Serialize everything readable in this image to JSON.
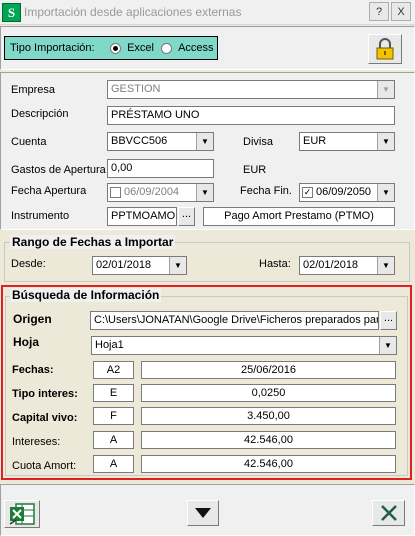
{
  "window": {
    "title": "Importación desde aplicaciones externas",
    "app_icon_letter": "S",
    "help_label": "?",
    "close_label": "X"
  },
  "tipo": {
    "label": "Tipo Importación:",
    "options": [
      "Excel",
      "Access"
    ],
    "selected": "Excel"
  },
  "fields": {
    "empresa_label": "Empresa",
    "empresa_value": "GESTION",
    "descripcion_label": "Descripción",
    "descripcion_value": "PRÉSTAMO UNO",
    "cuenta_label": "Cuenta",
    "cuenta_value": "BBVCC506",
    "divisa_label": "Divisa",
    "divisa_value": "EUR",
    "gastos_label": "Gastos de Apertura",
    "gastos_value": "0,00",
    "gastos_currency": "EUR",
    "fecha_apertura_label": "Fecha Apertura",
    "fecha_apertura_value": "06/09/2004",
    "fecha_fin_label": "Fecha Fin.",
    "fecha_fin_value": "06/09/2050",
    "fecha_fin_checked": "✓",
    "instrumento_label": "Instrumento",
    "instrumento_value": "PPTMOAMO",
    "instrumento_btn": "...",
    "instrumento_desc": "Pago Amort Prestamo (PTMO)"
  },
  "rango": {
    "legend": "Rango de Fechas a Importar",
    "desde_label": "Desde:",
    "desde_value": "02/01/2018",
    "hasta_label": "Hasta:",
    "hasta_value": "02/01/2018"
  },
  "busqueda": {
    "legend": "Búsqueda de Información",
    "origen_label": "Origen",
    "origen_value": "C:\\Users\\JONATAN\\Google Drive\\Ficheros preparados par",
    "origen_btn": "...",
    "hoja_label": "Hoja",
    "hoja_value": "Hoja1",
    "rows": [
      {
        "label": "Fechas:",
        "bold": true,
        "col": "A2",
        "value": "25/06/2016"
      },
      {
        "label": "Tipo interes:",
        "bold": true,
        "col": "E",
        "value": "0,0250"
      },
      {
        "label": "Capital vivo:",
        "bold": true,
        "col": "F",
        "value": "3.450,00"
      },
      {
        "label": "Intereses:",
        "bold": false,
        "col": "A",
        "value": "42.546,00"
      },
      {
        "label": "Cuota Amort:",
        "bold": false,
        "col": "A",
        "value": "42.546,00"
      }
    ]
  },
  "colors": {
    "accent_green": "#1f7a3a",
    "highlight_red": "#e02020",
    "lock_yellow": "#f2c400",
    "tipo_bg": "#7fd8c8"
  },
  "icons": [
    "excel-icon",
    "arrow-down-icon",
    "close-x-icon",
    "lock-icon"
  ]
}
